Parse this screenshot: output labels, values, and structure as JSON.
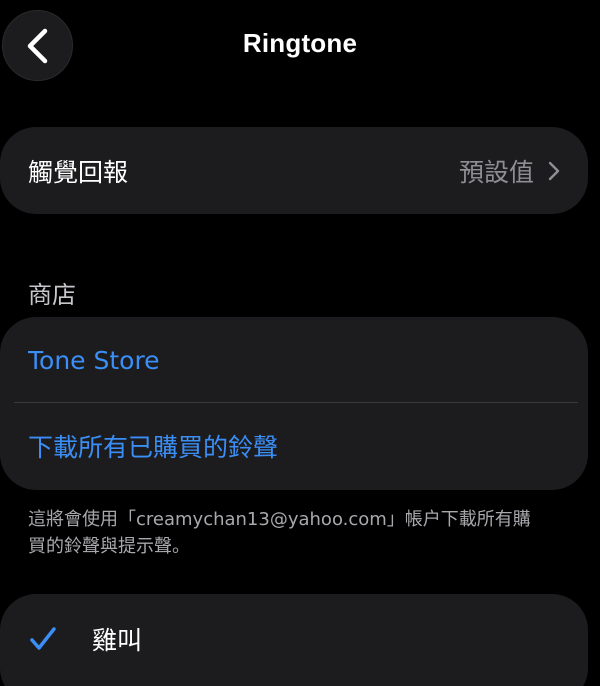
{
  "nav": {
    "title": "Ringtone",
    "back_icon": "chevron-left-icon"
  },
  "haptics": {
    "label": "觸覺回報",
    "value": "預設值",
    "chevron_icon": "chevron-right-icon"
  },
  "store": {
    "header": "商店",
    "items": [
      {
        "label": "Tone Store"
      },
      {
        "label": "下載所有已購買的鈴聲"
      }
    ],
    "footer": "這將會使用「creamychan13@yahoo.com」帳户下載所有購買的鈴聲與提示聲。"
  },
  "tones": {
    "items": [
      {
        "label": "雞叫",
        "selected": true,
        "check_icon": "checkmark-icon"
      }
    ]
  },
  "colors": {
    "background": "#000000",
    "group": "#1c1c1e",
    "accent": "#3a8ef6",
    "secondary_text": "#8e8e93"
  }
}
